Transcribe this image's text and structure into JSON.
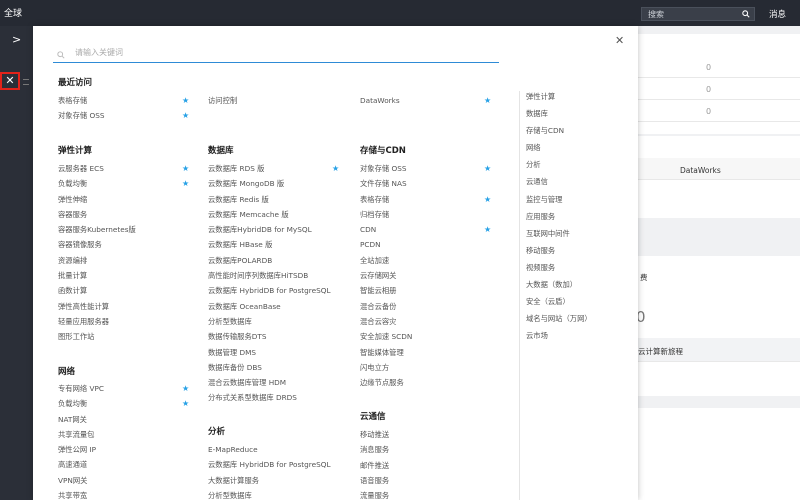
{
  "topbar": {
    "region": "全球",
    "search_placeholder": "搜索",
    "messages": "消息"
  },
  "sidebar": {
    "expand": ">",
    "close": "✕"
  },
  "background": {
    "zeros": [
      "0",
      "0",
      "0"
    ],
    "dataworks": "DataWorks",
    "frag1": "费",
    "big_zero": "0",
    "frag2": "云计算新旅程"
  },
  "modal": {
    "close": "✕",
    "search_placeholder": "请输入关键词",
    "recent": {
      "title": "最近访问",
      "col1": [
        {
          "label": "表格存储",
          "star": true
        },
        {
          "label": "对象存储 OSS",
          "star": true
        }
      ],
      "col2": [
        {
          "label": "访问控制",
          "star": false
        }
      ],
      "col3": [
        {
          "label": "DataWorks",
          "star": true
        }
      ]
    },
    "elastic": {
      "title": "弹性计算",
      "items": [
        {
          "label": "云服务器 ECS",
          "star": true
        },
        {
          "label": "负载均衡",
          "star": true
        },
        {
          "label": "弹性伸缩",
          "star": false
        },
        {
          "label": "容器服务",
          "star": false
        },
        {
          "label": "容器服务Kubernetes版",
          "star": false
        },
        {
          "label": "容器镜像服务",
          "star": false
        },
        {
          "label": "资源编排",
          "star": false
        },
        {
          "label": "批量计算",
          "star": false
        },
        {
          "label": "函数计算",
          "star": false
        },
        {
          "label": "弹性高性能计算",
          "star": false
        },
        {
          "label": "轻量应用服务器",
          "star": false
        },
        {
          "label": "图形工作站",
          "star": false
        }
      ]
    },
    "network": {
      "title": "网络",
      "items": [
        {
          "label": "专有网络 VPC",
          "star": true
        },
        {
          "label": "负载均衡",
          "star": true
        },
        {
          "label": "NAT网关",
          "star": false
        },
        {
          "label": "共享流量包",
          "star": false
        },
        {
          "label": "弹性公网 IP",
          "star": false
        },
        {
          "label": "高速通道",
          "star": false
        },
        {
          "label": "VPN网关",
          "star": false
        },
        {
          "label": "共享带宽",
          "star": false
        }
      ]
    },
    "database": {
      "title": "数据库",
      "items": [
        {
          "label": "云数据库 RDS 版",
          "star": true
        },
        {
          "label": "云数据库 MongoDB 版",
          "star": false
        },
        {
          "label": "云数据库 Redis 版",
          "star": false
        },
        {
          "label": "云数据库 Memcache 版",
          "star": false
        },
        {
          "label": "云数据库HybridDB for MySQL",
          "star": false
        },
        {
          "label": "云数据库 HBase 版",
          "star": false
        },
        {
          "label": "云数据库POLARDB",
          "star": false
        },
        {
          "label": "高性能时间序列数据库HiTSDB",
          "star": false
        },
        {
          "label": "云数据库 HybridDB for PostgreSQL",
          "star": false
        },
        {
          "label": "云数据库 OceanBase",
          "star": false
        },
        {
          "label": "分析型数据库",
          "star": false
        },
        {
          "label": "数据传输服务DTS",
          "star": false
        },
        {
          "label": "数据管理 DMS",
          "star": false
        },
        {
          "label": "数据库备份 DBS",
          "star": false
        },
        {
          "label": "混合云数据库管理 HDM",
          "star": false
        },
        {
          "label": "分布式关系型数据库 DRDS",
          "star": false
        }
      ]
    },
    "analysis": {
      "title": "分析",
      "items": [
        {
          "label": "E-MapReduce",
          "star": false
        },
        {
          "label": "云数据库 HybridDB for PostgreSQL",
          "star": false
        },
        {
          "label": "大数据计算服务",
          "star": false
        },
        {
          "label": "分析型数据库",
          "star": false
        }
      ]
    },
    "storage": {
      "title": "存储与CDN",
      "items": [
        {
          "label": "对象存储 OSS",
          "star": true
        },
        {
          "label": "文件存储 NAS",
          "star": false
        },
        {
          "label": "表格存储",
          "star": true
        },
        {
          "label": "归档存储",
          "star": false
        },
        {
          "label": "CDN",
          "star": true
        },
        {
          "label": "PCDN",
          "star": false
        },
        {
          "label": "全站加速",
          "star": false
        },
        {
          "label": "云存储网关",
          "star": false
        },
        {
          "label": "智能云相册",
          "star": false
        },
        {
          "label": "混合云备份",
          "star": false
        },
        {
          "label": "混合云容灾",
          "star": false
        },
        {
          "label": "安全加速 SCDN",
          "star": false
        },
        {
          "label": "智能媒体管理",
          "star": false
        },
        {
          "label": "闪电立方",
          "star": false
        },
        {
          "label": "边缘节点服务",
          "star": false
        }
      ]
    },
    "comm": {
      "title": "云通信",
      "items": [
        {
          "label": "移动推送",
          "star": false
        },
        {
          "label": "消息服务",
          "star": false
        },
        {
          "label": "邮件推送",
          "star": false
        },
        {
          "label": "语音服务",
          "star": false
        },
        {
          "label": "流量服务",
          "star": false
        }
      ]
    },
    "nav": [
      "弹性计算",
      "数据库",
      "存储与CDN",
      "网络",
      "分析",
      "云通信",
      "监控与管理",
      "应用服务",
      "互联网中间件",
      "移动服务",
      "视频服务",
      "大数据（数加）",
      "安全（云盾）",
      "域名与网站（万网）",
      "云市场"
    ]
  }
}
